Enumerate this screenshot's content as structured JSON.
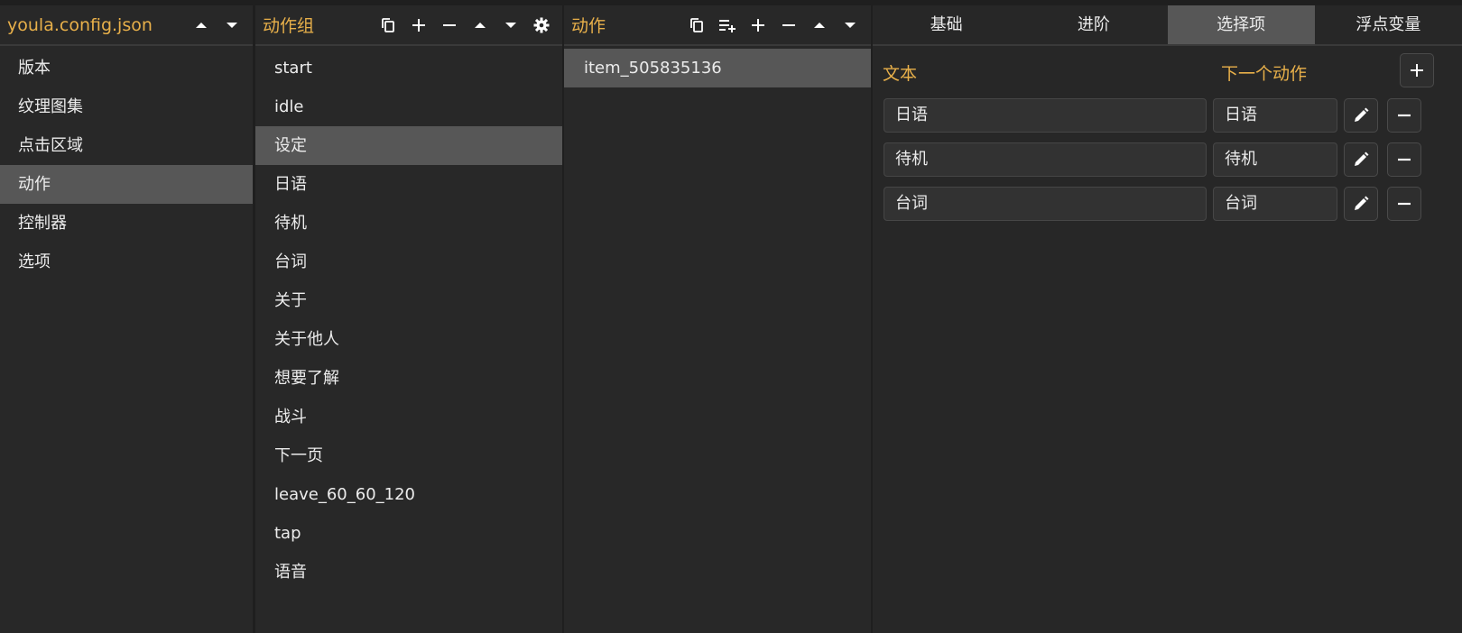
{
  "files": {
    "title": "youla.config.json",
    "items": [
      "版本",
      "纹理图集",
      "点击区域",
      "动作",
      "控制器",
      "选项"
    ],
    "selected_index": 3
  },
  "groups": {
    "title": "动作组",
    "items": [
      "start",
      "idle",
      "设定",
      "日语",
      "待机",
      "台词",
      "关于",
      "关于他人",
      "想要了解",
      "战斗",
      "下一页",
      "leave_60_60_120",
      "tap",
      "语音"
    ],
    "selected_index": 2
  },
  "actions": {
    "title": "动作",
    "items": [
      "item_505835136"
    ],
    "selected_index": 0
  },
  "tabs": {
    "items": [
      "基础",
      "进阶",
      "选择项",
      "浮点变量"
    ],
    "active_index": 2
  },
  "options": {
    "text_label": "文本",
    "next_label": "下一个动作",
    "rows": [
      {
        "text": "日语",
        "next": "日语"
      },
      {
        "text": "待机",
        "next": "待机"
      },
      {
        "text": "台词",
        "next": "台词"
      }
    ]
  },
  "icons": {
    "files_toolbar": [
      "arrow-up-icon",
      "arrow-down-icon"
    ],
    "groups_toolbar": [
      "copy-icon",
      "plus-icon",
      "minus-icon",
      "arrow-up-icon",
      "arrow-down-icon",
      "gear-icon"
    ],
    "actions_toolbar": [
      "copy-icon",
      "playlist-add-icon",
      "plus-icon",
      "minus-icon",
      "arrow-up-icon",
      "arrow-down-icon"
    ]
  },
  "colors": {
    "accent": "#e8b04a",
    "selected_bg": "#575757",
    "panel_bg": "#282828"
  }
}
